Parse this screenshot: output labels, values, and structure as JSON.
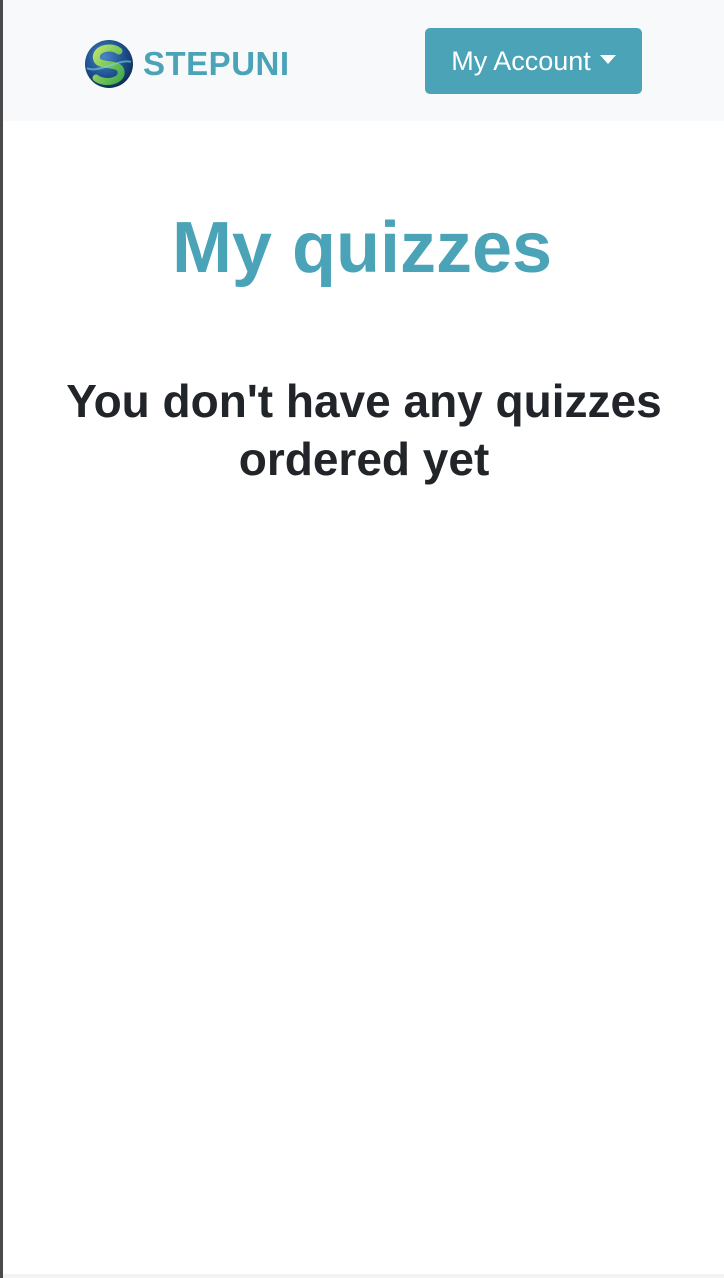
{
  "navbar": {
    "brand_name": "STEPUNI",
    "account_button_label": "My Account"
  },
  "main": {
    "title": "My quizzes",
    "empty_message": "You don't have any quizzes ordered yet"
  },
  "colors": {
    "brand": "#4aa3b7",
    "text_dark": "#212529",
    "navbar_bg": "#f8f9fa"
  },
  "icons": {
    "logo": "stepuni-globe-logo",
    "dropdown": "caret-down-icon"
  }
}
